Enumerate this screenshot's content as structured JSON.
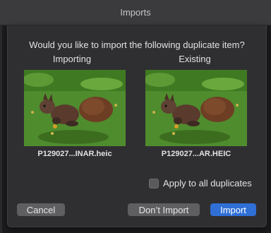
{
  "window": {
    "title": "Imports"
  },
  "dialog": {
    "question": "Would you like to import the following duplicate item?",
    "importing": {
      "header": "Importing",
      "filename": "P129027...INAR.heic"
    },
    "existing": {
      "header": "Existing",
      "filename": "P129027...AR.HEIC"
    },
    "apply_all": {
      "label": "Apply to all duplicates",
      "checked": false
    },
    "buttons": {
      "cancel": "Cancel",
      "dont_import": "Don’t Import",
      "import": "Import"
    }
  },
  "colors": {
    "primary_button": "#2f6fd6",
    "sheet_background": "#2f2f31"
  }
}
